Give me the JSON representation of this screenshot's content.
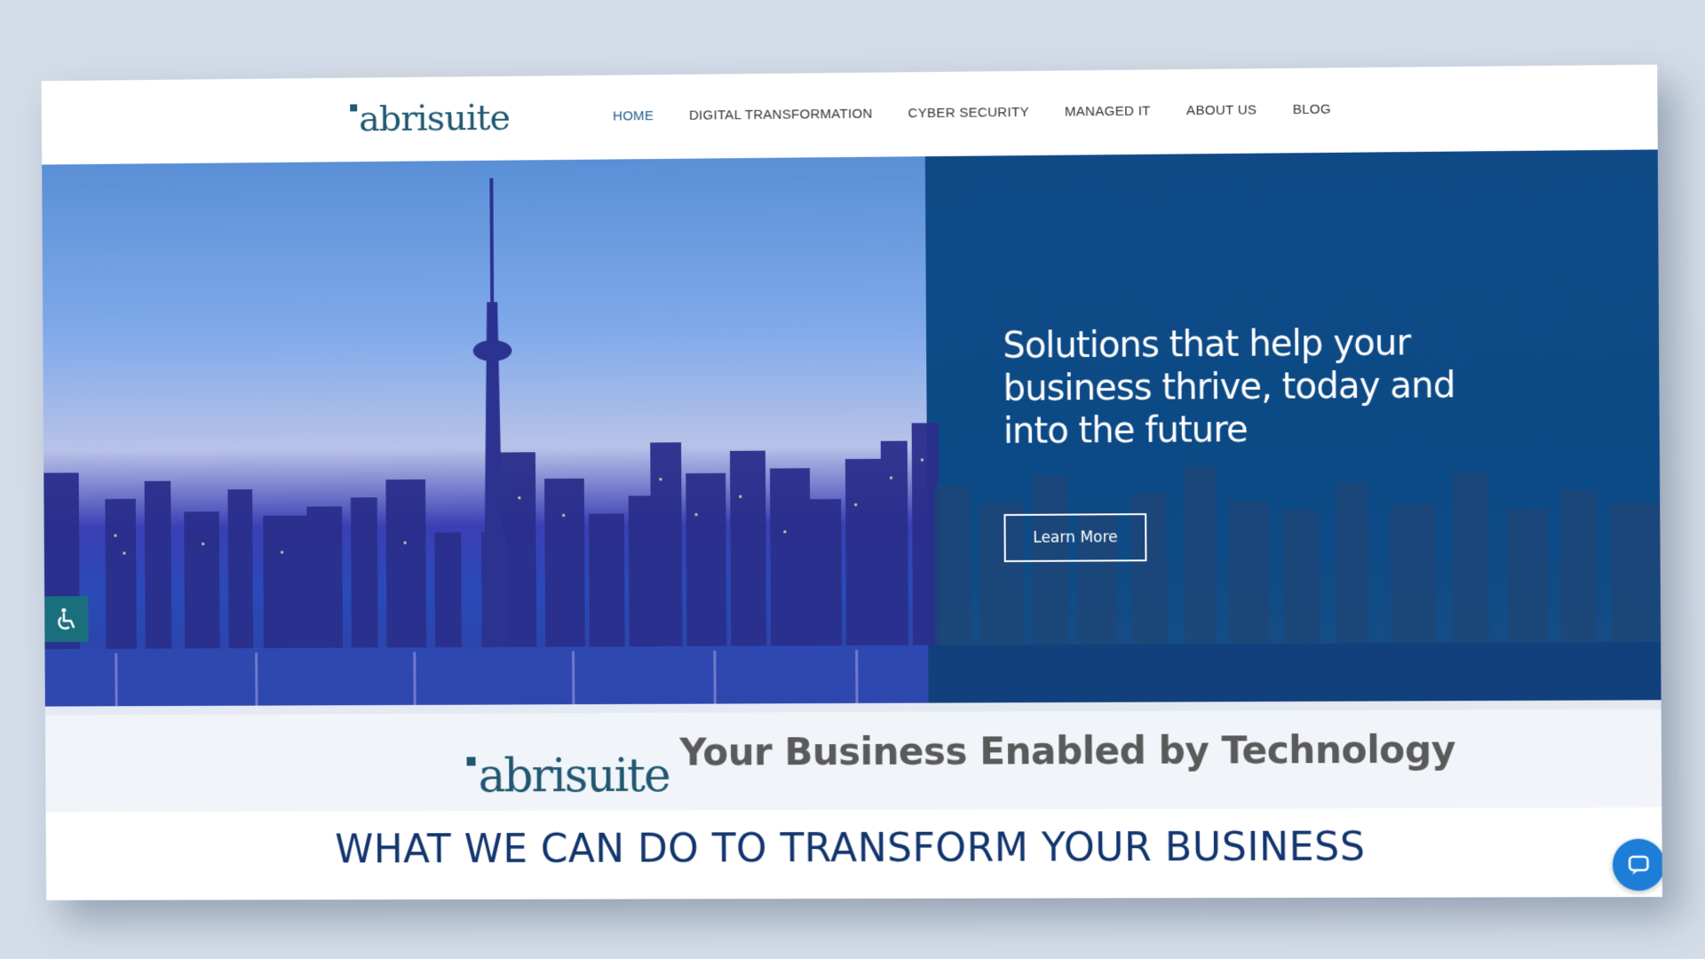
{
  "header": {
    "logo_text": "abrisuite",
    "nav": [
      {
        "label": "HOME",
        "active": true
      },
      {
        "label": "DIGITAL TRANSFORMATION",
        "active": false
      },
      {
        "label": "CYBER SECURITY",
        "active": false
      },
      {
        "label": "MANAGED IT",
        "active": false
      },
      {
        "label": "ABOUT US",
        "active": false
      },
      {
        "label": "BLOG",
        "active": false
      }
    ]
  },
  "hero": {
    "headline": "Solutions that help your business thrive, today and into the future",
    "cta_label": "Learn More"
  },
  "tagline": {
    "logo_text": "abrisuite",
    "text": "Your Business Enabled by Technology"
  },
  "section": {
    "title": "WHAT WE CAN DO TO TRANSFORM YOUR BUSINESS"
  },
  "widgets": {
    "accessibility_icon": "wheelchair-icon",
    "chat_icon": "chat-bubble-icon"
  },
  "colors": {
    "brand": "#1f5870",
    "nav_active": "#1f5b8e",
    "hero_panel": "#0b4a86",
    "section_title": "#12356e",
    "chat": "#1d7ed8",
    "accessibility": "#1a6f7c"
  }
}
